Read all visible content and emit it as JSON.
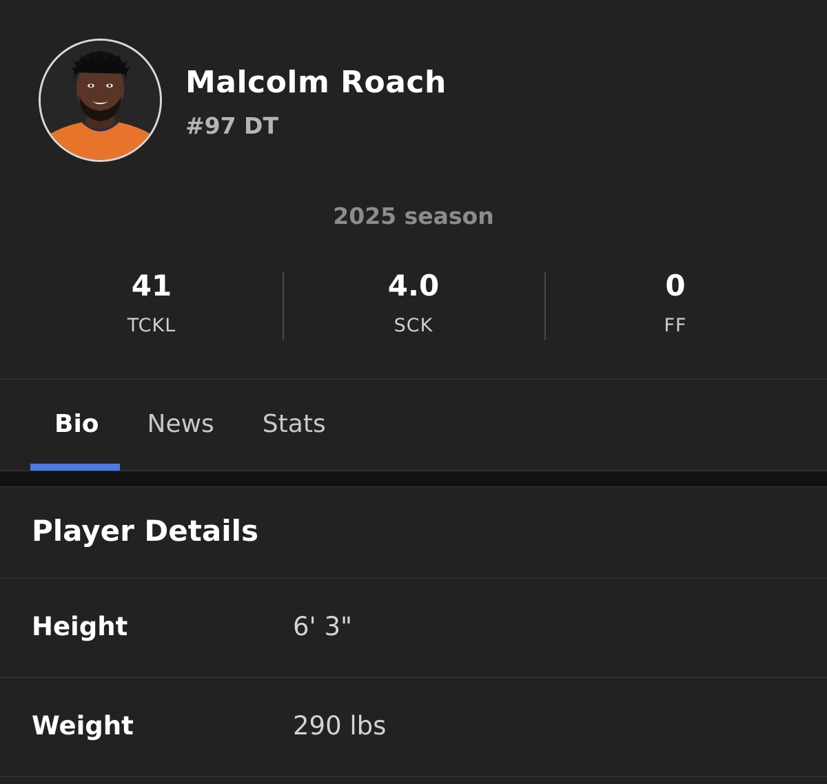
{
  "player": {
    "name": "Malcolm Roach",
    "meta": "#97 DT"
  },
  "season": {
    "label": "2025 season",
    "stats": [
      {
        "value": "41",
        "label": "TCKL"
      },
      {
        "value": "4.0",
        "label": "SCK"
      },
      {
        "value": "0",
        "label": "FF"
      }
    ]
  },
  "tabs": [
    {
      "label": "Bio",
      "active": true
    },
    {
      "label": "News",
      "active": false
    },
    {
      "label": "Stats",
      "active": false
    }
  ],
  "details": {
    "title": "Player Details",
    "rows": [
      {
        "label": "Height",
        "value": "6' 3\""
      },
      {
        "label": "Weight",
        "value": "290 lbs"
      }
    ]
  },
  "colors": {
    "background": "#222223",
    "tab_accent": "#4b7be5",
    "jersey": "#e8742c",
    "jersey_trim": "#1f2d4e"
  }
}
